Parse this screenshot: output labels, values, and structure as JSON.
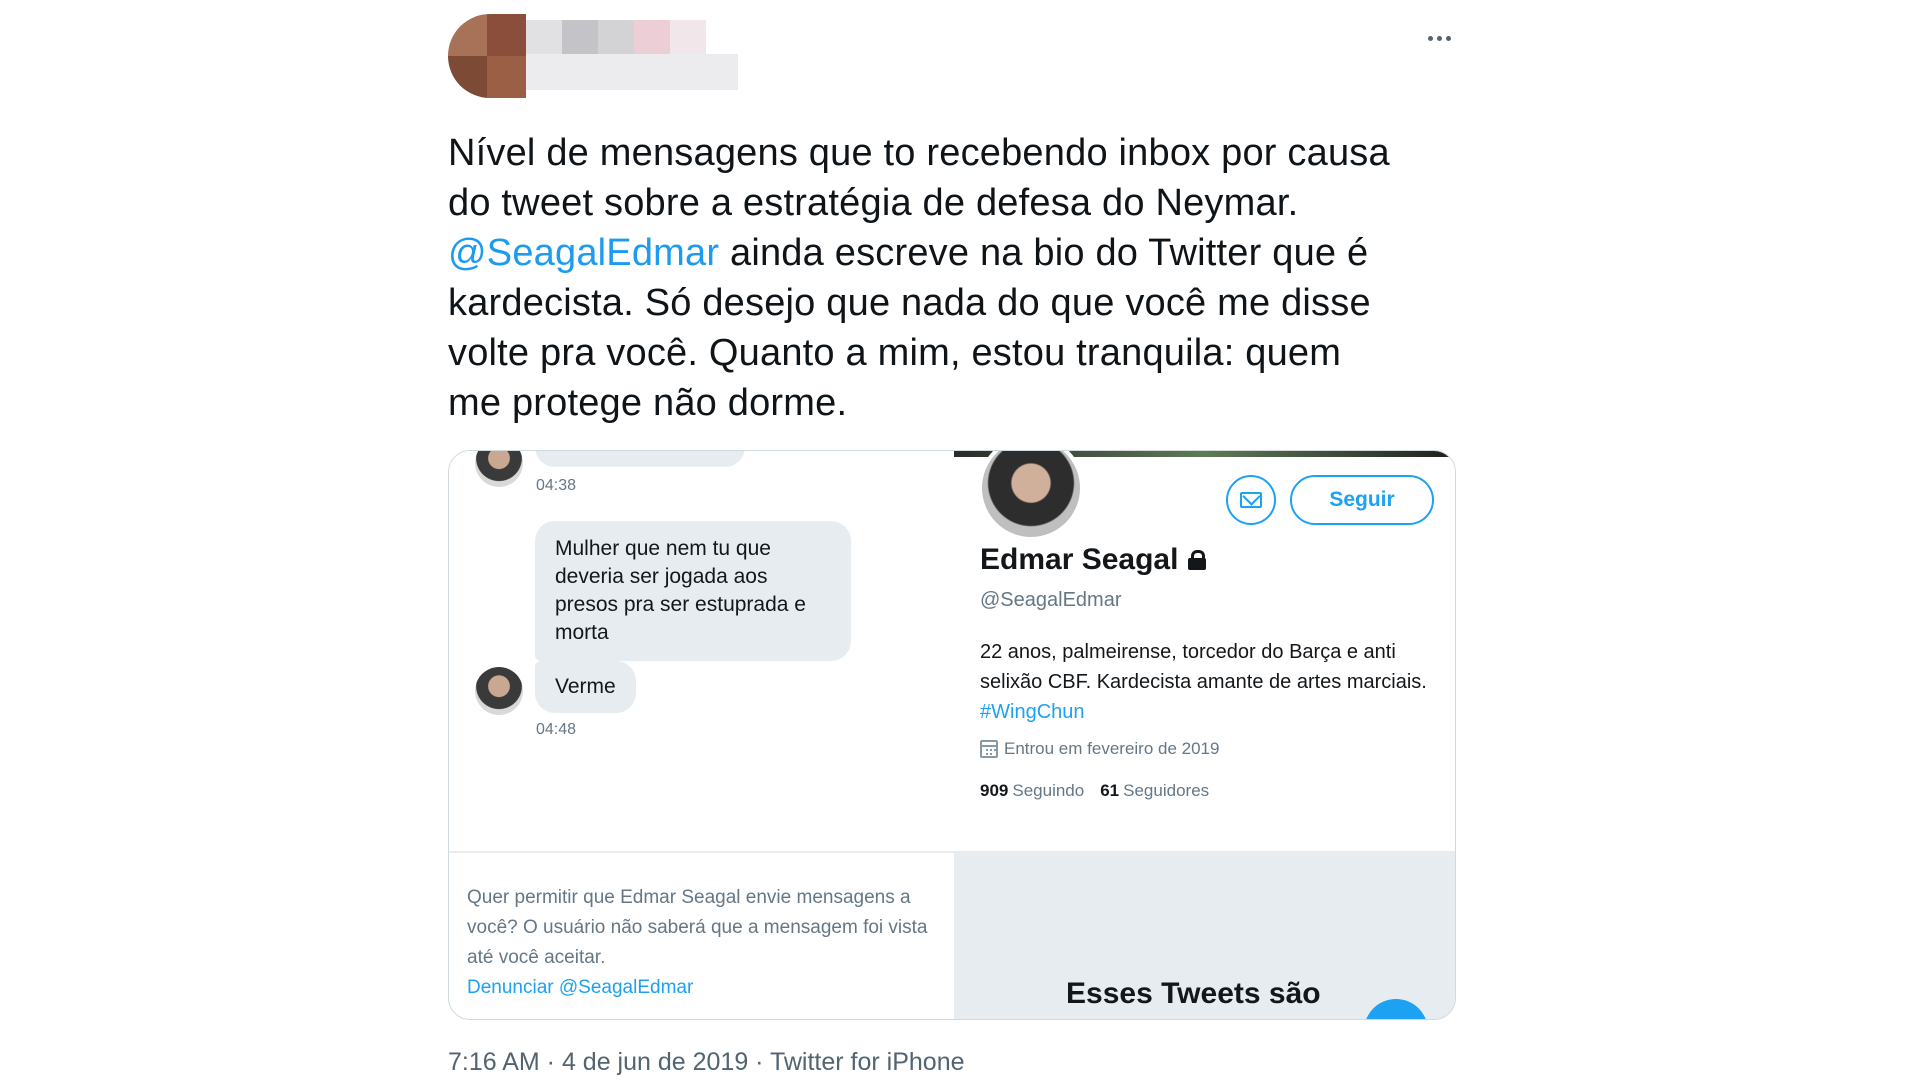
{
  "tweet": {
    "text_lines": [
      "Nível de mensagens que to recebendo inbox por causa",
      "do tweet sobre a estratégia de defesa do Neymar.",
      "ainda escreve na bio do Twitter que é",
      "kardecista. Só desejo que nada do que você me disse",
      "volte pra você. Quanto a mim, estou tranquila: quem",
      "me protege não dorme."
    ],
    "mention": "@SeagalEdmar",
    "meta": "7:16 AM · 4 de jun de 2019 · Twitter for iPhone",
    "icons": {
      "more": "more-horizontal-icon"
    }
  },
  "dm": {
    "time_1": "04:38",
    "message_1": "Mulher que nem tu que deveria ser jogada aos presos pra ser estuprada e morta",
    "message_2": "Verme",
    "time_2": "04:48",
    "request_text": "Quer permitir que Edmar Seagal envie mensagens a você? O usuário não saberá que a mensagem foi vista até você aceitar.",
    "report_link": "Denunciar @SeagalEdmar"
  },
  "profile": {
    "name": "Edmar Seagal",
    "handle": "@SeagalEdmar",
    "bio": "22 anos, palmeirense, torcedor do Barça e anti selixão CBF. Kardecista amante de artes marciais.",
    "hashtag": "#WingChun",
    "joined": "Entrou em fevereiro de 2019",
    "following_count": "909",
    "following_label": "Seguindo",
    "followers_count": "61",
    "followers_label": "Seguidores",
    "follow_button": "Seguir",
    "protected_title": "Esses Tweets são"
  },
  "colors": {
    "link": "#1d9bf0",
    "card_link": "#1da1f2",
    "text": "#0f1419",
    "muted": "#536471",
    "bubble": "#e6ecf0"
  }
}
